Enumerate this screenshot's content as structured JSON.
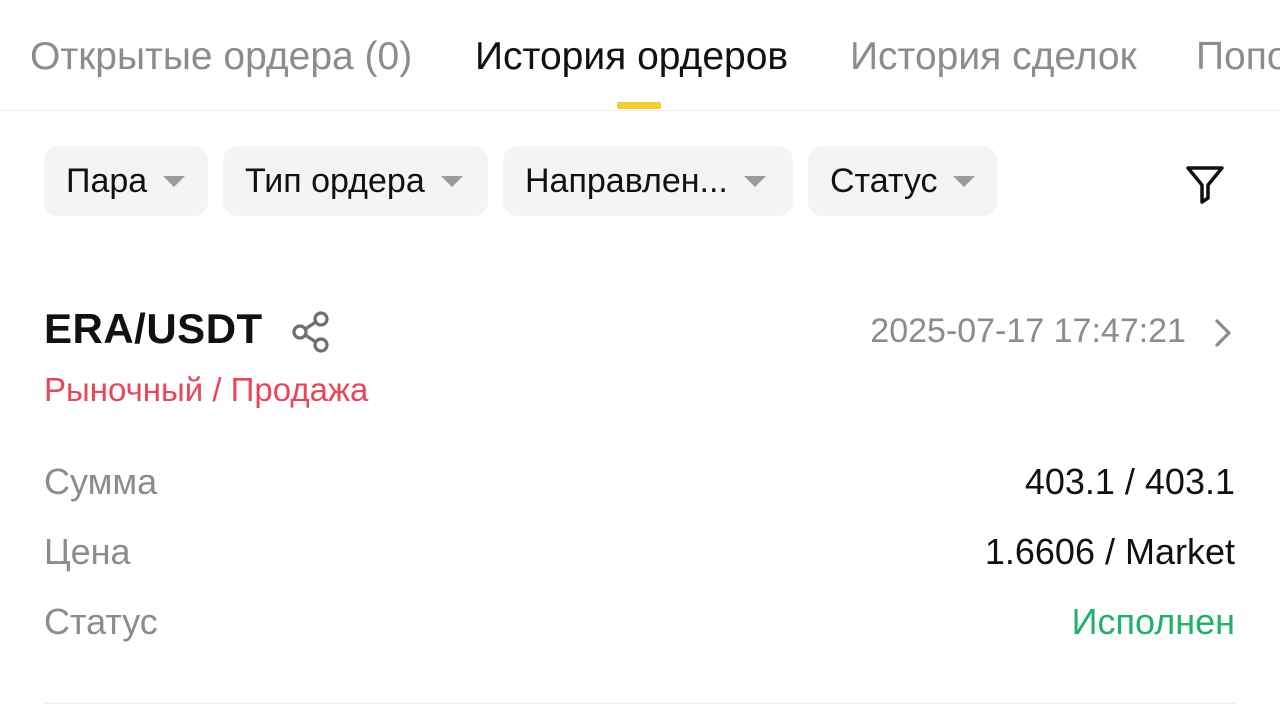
{
  "tabs": [
    {
      "label": "Открытые ордера (0)"
    },
    {
      "label": "История ордеров"
    },
    {
      "label": "История сделок"
    },
    {
      "label": "Попо"
    }
  ],
  "active_tab": "История ордеров",
  "filters": [
    {
      "label": "Пара"
    },
    {
      "label": "Тип ордера"
    },
    {
      "label": "Направлен..."
    },
    {
      "label": "Статус"
    }
  ],
  "order": {
    "pair": "ERA/USDT",
    "datetime": "2025-07-17 17:47:21",
    "type": "Рыночный / Продажа",
    "rows": [
      {
        "label": "Сумма",
        "value": "403.1 / 403.1"
      },
      {
        "label": "Цена",
        "value": "1.6606 / Market"
      },
      {
        "label": "Статус",
        "value": "Исполнен"
      }
    ]
  },
  "colors": {
    "accent": "#f2cd34",
    "sell": "#e8475b",
    "filled": "#20b26c",
    "muted": "#8c8c8c"
  },
  "icons": [
    "share-icon",
    "filter-icon",
    "chevron-right-icon",
    "caret-down-icon"
  ]
}
